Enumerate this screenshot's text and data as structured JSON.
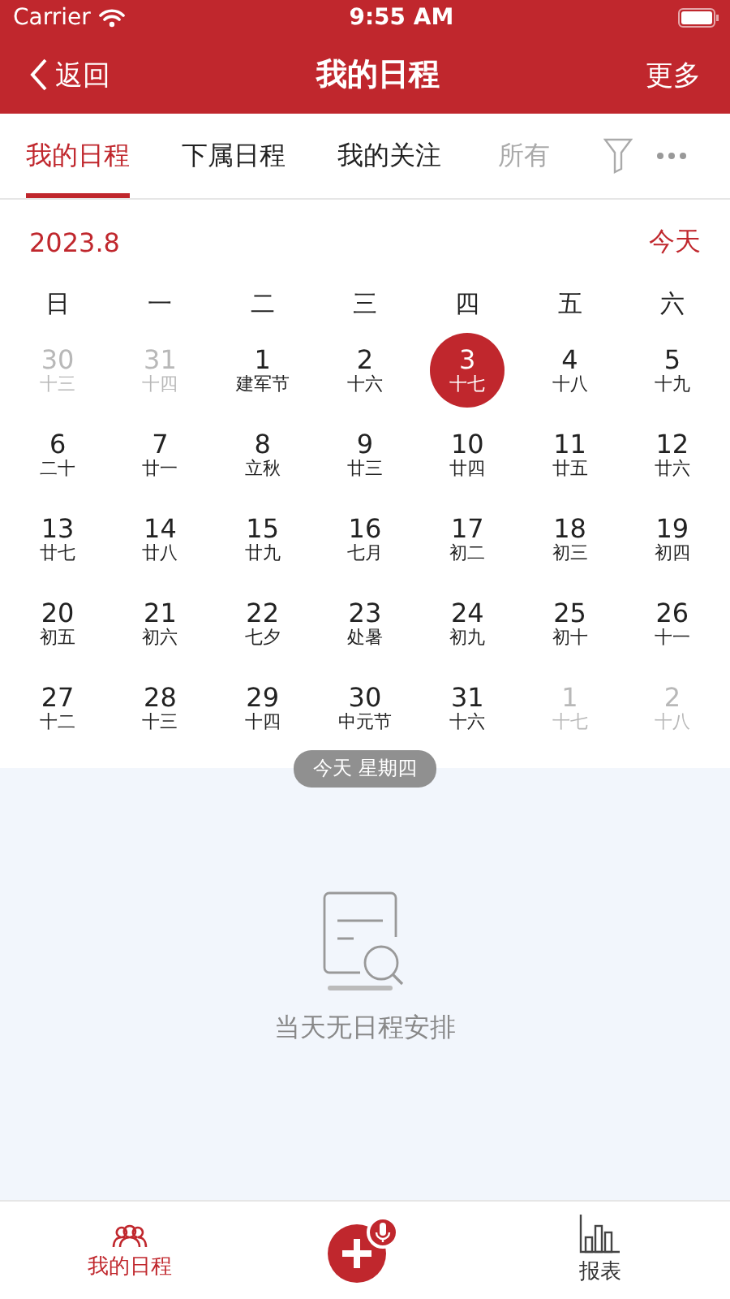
{
  "status_bar": {
    "carrier": "Carrier",
    "time": "9:55 AM"
  },
  "nav": {
    "back": "返回",
    "title": "我的日程",
    "more": "更多"
  },
  "tabs": [
    {
      "label": "我的日程",
      "selected": true
    },
    {
      "label": "下属日程",
      "selected": false
    },
    {
      "label": "我的关注",
      "selected": false
    },
    {
      "label": "所有",
      "selected": false
    }
  ],
  "calendar": {
    "month": "2023.8",
    "today_button": "今天",
    "weekdays": [
      "日",
      "一",
      "二",
      "三",
      "四",
      "五",
      "六"
    ],
    "days": [
      {
        "day": "30",
        "lunar": "十三",
        "muted": true,
        "selected": false
      },
      {
        "day": "31",
        "lunar": "十四",
        "muted": true,
        "selected": false
      },
      {
        "day": "1",
        "lunar": "建军节",
        "muted": false,
        "selected": false
      },
      {
        "day": "2",
        "lunar": "十六",
        "muted": false,
        "selected": false
      },
      {
        "day": "3",
        "lunar": "十七",
        "muted": false,
        "selected": true
      },
      {
        "day": "4",
        "lunar": "十八",
        "muted": false,
        "selected": false
      },
      {
        "day": "5",
        "lunar": "十九",
        "muted": false,
        "selected": false
      },
      {
        "day": "6",
        "lunar": "二十",
        "muted": false,
        "selected": false
      },
      {
        "day": "7",
        "lunar": "廿一",
        "muted": false,
        "selected": false
      },
      {
        "day": "8",
        "lunar": "立秋",
        "muted": false,
        "selected": false
      },
      {
        "day": "9",
        "lunar": "廿三",
        "muted": false,
        "selected": false
      },
      {
        "day": "10",
        "lunar": "廿四",
        "muted": false,
        "selected": false
      },
      {
        "day": "11",
        "lunar": "廿五",
        "muted": false,
        "selected": false
      },
      {
        "day": "12",
        "lunar": "廿六",
        "muted": false,
        "selected": false
      },
      {
        "day": "13",
        "lunar": "廿七",
        "muted": false,
        "selected": false
      },
      {
        "day": "14",
        "lunar": "廿八",
        "muted": false,
        "selected": false
      },
      {
        "day": "15",
        "lunar": "廿九",
        "muted": false,
        "selected": false
      },
      {
        "day": "16",
        "lunar": "七月",
        "muted": false,
        "selected": false
      },
      {
        "day": "17",
        "lunar": "初二",
        "muted": false,
        "selected": false
      },
      {
        "day": "18",
        "lunar": "初三",
        "muted": false,
        "selected": false
      },
      {
        "day": "19",
        "lunar": "初四",
        "muted": false,
        "selected": false
      },
      {
        "day": "20",
        "lunar": "初五",
        "muted": false,
        "selected": false
      },
      {
        "day": "21",
        "lunar": "初六",
        "muted": false,
        "selected": false
      },
      {
        "day": "22",
        "lunar": "七夕",
        "muted": false,
        "selected": false
      },
      {
        "day": "23",
        "lunar": "处暑",
        "muted": false,
        "selected": false
      },
      {
        "day": "24",
        "lunar": "初九",
        "muted": false,
        "selected": false
      },
      {
        "day": "25",
        "lunar": "初十",
        "muted": false,
        "selected": false
      },
      {
        "day": "26",
        "lunar": "十一",
        "muted": false,
        "selected": false
      },
      {
        "day": "27",
        "lunar": "十二",
        "muted": false,
        "selected": false
      },
      {
        "day": "28",
        "lunar": "十三",
        "muted": false,
        "selected": false
      },
      {
        "day": "29",
        "lunar": "十四",
        "muted": false,
        "selected": false
      },
      {
        "day": "30",
        "lunar": "中元节",
        "muted": false,
        "selected": false
      },
      {
        "day": "31",
        "lunar": "十六",
        "muted": false,
        "selected": false
      },
      {
        "day": "1",
        "lunar": "十七",
        "muted": true,
        "selected": false
      },
      {
        "day": "2",
        "lunar": "十八",
        "muted": true,
        "selected": false
      }
    ],
    "today_label": "今天 星期四"
  },
  "empty_state": {
    "message": "当天无日程安排"
  },
  "tab_bar": [
    {
      "kind": "people",
      "label": "我的日程",
      "selected": true
    },
    {
      "kind": "add"
    },
    {
      "kind": "chart",
      "label": "报表",
      "selected": false
    }
  ]
}
